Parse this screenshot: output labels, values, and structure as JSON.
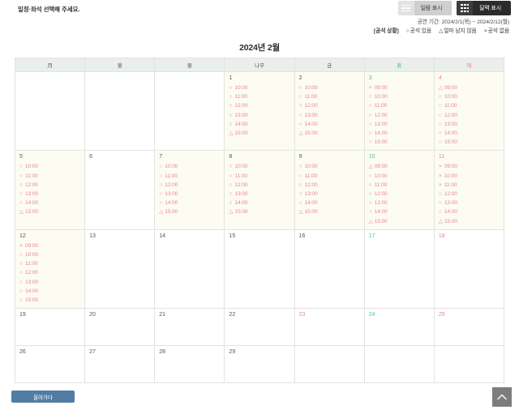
{
  "header": {
    "instruction": "일정·좌석 선택해 주세요.",
    "view_toggle": {
      "list_label": "일람 표시",
      "calendar_label": "달력 표시",
      "active": "calendar"
    },
    "period": "공연 기간: 2024/2/1(목) − 2024/2/12(월)",
    "legend": {
      "title": "[공석 상황]",
      "available_symbol": "○",
      "available_label": "공석 있음",
      "few_symbol": "△",
      "few_label": "얼마 남지 않음",
      "none_symbol": "×",
      "none_label": "공석 없음"
    }
  },
  "calendar": {
    "month_title": "2024년 2월",
    "weekdays": [
      "月",
      "불",
      "물",
      "나무",
      "금",
      "흙",
      "해"
    ],
    "weeks": [
      [
        {
          "day": "",
          "slots": []
        },
        {
          "day": "",
          "slots": []
        },
        {
          "day": "",
          "slots": []
        },
        {
          "day": "1",
          "slots": [
            {
              "mark": "○",
              "time": "10:00"
            },
            {
              "mark": "○",
              "time": "11:00"
            },
            {
              "mark": "○",
              "time": "12:00"
            },
            {
              "mark": "○",
              "time": "13:00"
            },
            {
              "mark": "○",
              "time": "14:00"
            },
            {
              "mark": "△",
              "time": "15:00"
            }
          ]
        },
        {
          "day": "2",
          "slots": [
            {
              "mark": "○",
              "time": "10:00"
            },
            {
              "mark": "○",
              "time": "11:00"
            },
            {
              "mark": "○",
              "time": "12:00"
            },
            {
              "mark": "○",
              "time": "13:00"
            },
            {
              "mark": "○",
              "time": "14:00"
            },
            {
              "mark": "△",
              "time": "15:00"
            }
          ]
        },
        {
          "day": "3",
          "kind": "sat",
          "slots": [
            {
              "mark": "×",
              "time": "09:00"
            },
            {
              "mark": "○",
              "time": "10:00"
            },
            {
              "mark": "○",
              "time": "11:00"
            },
            {
              "mark": "○",
              "time": "12:00"
            },
            {
              "mark": "○",
              "time": "13:00"
            },
            {
              "mark": "○",
              "time": "14:00"
            },
            {
              "mark": "○",
              "time": "15:00"
            }
          ]
        },
        {
          "day": "4",
          "kind": "sun",
          "slots": [
            {
              "mark": "△",
              "time": "09:00"
            },
            {
              "mark": "○",
              "time": "10:00"
            },
            {
              "mark": "○",
              "time": "11:00"
            },
            {
              "mark": "○",
              "time": "12:00"
            },
            {
              "mark": "○",
              "time": "13:00"
            },
            {
              "mark": "○",
              "time": "14:00"
            },
            {
              "mark": "○",
              "time": "15:00"
            }
          ]
        }
      ],
      [
        {
          "day": "5",
          "slots": [
            {
              "mark": "○",
              "time": "10:00"
            },
            {
              "mark": "○",
              "time": "11:00"
            },
            {
              "mark": "○",
              "time": "12:00"
            },
            {
              "mark": "○",
              "time": "13:00"
            },
            {
              "mark": "○",
              "time": "14:00"
            },
            {
              "mark": "△",
              "time": "15:00"
            }
          ]
        },
        {
          "day": "6",
          "slots": []
        },
        {
          "day": "7",
          "slots": [
            {
              "mark": "○",
              "time": "10:00"
            },
            {
              "mark": "○",
              "time": "11:00"
            },
            {
              "mark": "○",
              "time": "12:00"
            },
            {
              "mark": "○",
              "time": "13:00"
            },
            {
              "mark": "○",
              "time": "14:00"
            },
            {
              "mark": "△",
              "time": "15:00"
            }
          ]
        },
        {
          "day": "8",
          "slots": [
            {
              "mark": "○",
              "time": "10:00"
            },
            {
              "mark": "○",
              "time": "11:00"
            },
            {
              "mark": "○",
              "time": "12:00"
            },
            {
              "mark": "○",
              "time": "13:00"
            },
            {
              "mark": "○",
              "time": "14:00"
            },
            {
              "mark": "△",
              "time": "15:00"
            }
          ]
        },
        {
          "day": "9",
          "slots": [
            {
              "mark": "○",
              "time": "10:00"
            },
            {
              "mark": "○",
              "time": "11:00"
            },
            {
              "mark": "○",
              "time": "12:00"
            },
            {
              "mark": "○",
              "time": "13:00"
            },
            {
              "mark": "○",
              "time": "14:00"
            },
            {
              "mark": "△",
              "time": "15:00"
            }
          ]
        },
        {
          "day": "10",
          "kind": "sat",
          "slots": [
            {
              "mark": "△",
              "time": "09:00"
            },
            {
              "mark": "○",
              "time": "10:00"
            },
            {
              "mark": "○",
              "time": "11:00"
            },
            {
              "mark": "○",
              "time": "12:00"
            },
            {
              "mark": "○",
              "time": "13:00"
            },
            {
              "mark": "○",
              "time": "14:00"
            },
            {
              "mark": "△",
              "time": "15:00"
            }
          ]
        },
        {
          "day": "11",
          "kind": "sun",
          "slots": [
            {
              "mark": "×",
              "time": "09:00"
            },
            {
              "mark": "×",
              "time": "10:00"
            },
            {
              "mark": "×",
              "time": "11:00"
            },
            {
              "mark": "○",
              "time": "12:00"
            },
            {
              "mark": "○",
              "time": "13:00"
            },
            {
              "mark": "○",
              "time": "14:00"
            },
            {
              "mark": "△",
              "time": "15:00"
            }
          ]
        }
      ],
      [
        {
          "day": "12",
          "slots": [
            {
              "mark": "×",
              "time": "09:00"
            },
            {
              "mark": "○",
              "time": "10:00"
            },
            {
              "mark": "○",
              "time": "11:00"
            },
            {
              "mark": "○",
              "time": "12:00"
            },
            {
              "mark": "○",
              "time": "13:00"
            },
            {
              "mark": "○",
              "time": "14:00"
            },
            {
              "mark": "○",
              "time": "15:00"
            }
          ]
        },
        {
          "day": "13",
          "slots": []
        },
        {
          "day": "14",
          "slots": []
        },
        {
          "day": "15",
          "slots": []
        },
        {
          "day": "16",
          "slots": []
        },
        {
          "day": "17",
          "kind": "sat",
          "slots": []
        },
        {
          "day": "18",
          "kind": "sun",
          "slots": []
        }
      ],
      [
        {
          "day": "19",
          "slots": []
        },
        {
          "day": "20",
          "slots": []
        },
        {
          "day": "21",
          "slots": []
        },
        {
          "day": "22",
          "slots": []
        },
        {
          "day": "23",
          "kind": "holiday",
          "slots": []
        },
        {
          "day": "24",
          "kind": "sat",
          "slots": []
        },
        {
          "day": "25",
          "kind": "sun",
          "slots": []
        }
      ],
      [
        {
          "day": "26",
          "slots": []
        },
        {
          "day": "27",
          "slots": []
        },
        {
          "day": "28",
          "slots": []
        },
        {
          "day": "29",
          "slots": []
        },
        {
          "day": "",
          "slots": []
        },
        {
          "day": "",
          "slots": []
        },
        {
          "day": "",
          "slots": []
        }
      ]
    ]
  },
  "footer": {
    "back_label": "돌아가다",
    "scroll_top_icon": "chevron-up-icon"
  },
  "colors": {
    "accent_pink": "#e8849b",
    "accent_teal": "#4fb8a8",
    "button_blue": "#517da4",
    "active_dark": "#2b2b2b",
    "slot_cell_bg": "#fdfcf2"
  }
}
